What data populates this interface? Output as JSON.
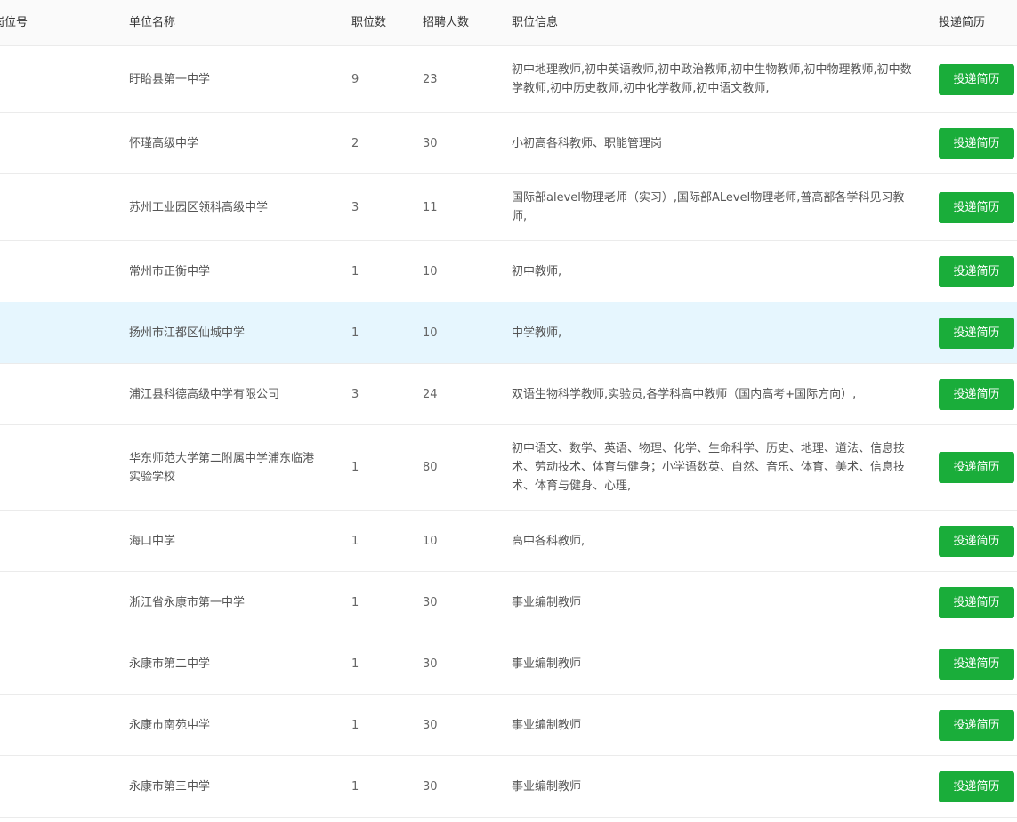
{
  "header": {
    "code": "岗位号",
    "name": "单位名称",
    "count": "职位数",
    "people": "招聘人数",
    "info": "职位信息",
    "action": "投递简历"
  },
  "apply_label": "投递简历",
  "colors": {
    "button": "#1aad3a",
    "highlight_row": "#e6f6fe",
    "header_bg": "#fafafa"
  },
  "rows": [
    {
      "name": "盱眙县第一中学",
      "count": "9",
      "people": "23",
      "info": "初中地理教师,初中英语教师,初中政治教师,初中生物教师,初中物理教师,初中数学教师,初中历史教师,初中化学教师,初中语文教师,"
    },
    {
      "name": "怀瑾高级中学",
      "count": "2",
      "people": "30",
      "info": "小初高各科教师、职能管理岗"
    },
    {
      "name": "苏州工业园区领科高级中学",
      "count": "3",
      "people": "11",
      "info": "国际部alevel物理老师（实习）,国际部ALevel物理老师,普高部各学科见习教师,"
    },
    {
      "name": "常州市正衡中学",
      "count": "1",
      "people": "10",
      "info": "初中教师,"
    },
    {
      "name": "扬州市江都区仙城中学",
      "count": "1",
      "people": "10",
      "info": "中学教师,"
    },
    {
      "name": "浦江县科德高级中学有限公司",
      "count": "3",
      "people": "24",
      "info": "双语生物科学教师,实验员,各学科高中教师（国内高考+国际方向）,"
    },
    {
      "name": "华东师范大学第二附属中学浦东临港实验学校",
      "count": "1",
      "people": "80",
      "info": "初中语文、数学、英语、物理、化学、生命科学、历史、地理、道法、信息技术、劳动技术、体育与健身；小学语数英、自然、音乐、体育、美术、信息技术、体育与健身、心理,"
    },
    {
      "name": "海口中学",
      "count": "1",
      "people": "10",
      "info": "高中各科教师,"
    },
    {
      "name": "浙江省永康市第一中学",
      "count": "1",
      "people": "30",
      "info": "事业编制教师"
    },
    {
      "name": "永康市第二中学",
      "count": "1",
      "people": "30",
      "info": "事业编制教师"
    },
    {
      "name": "永康市南苑中学",
      "count": "1",
      "people": "30",
      "info": "事业编制教师"
    },
    {
      "name": "永康市第三中学",
      "count": "1",
      "people": "30",
      "info": "事业编制教师"
    }
  ]
}
